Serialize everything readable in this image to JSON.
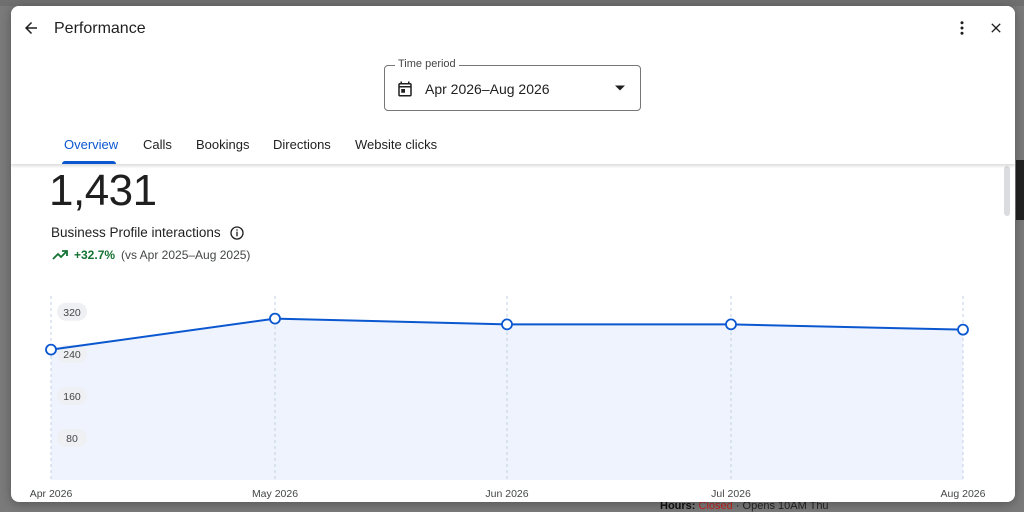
{
  "dialog": {
    "title": "Performance",
    "time_period": {
      "label": "Time period",
      "value": "Apr 2026–Aug 2026"
    },
    "tabs": [
      {
        "label": "Overview",
        "active": true
      },
      {
        "label": "Calls",
        "active": false
      },
      {
        "label": "Bookings",
        "active": false
      },
      {
        "label": "Directions",
        "active": false
      },
      {
        "label": "Website clicks",
        "active": false
      }
    ]
  },
  "summary": {
    "total": "1,431",
    "metric_label": "Business Profile interactions",
    "change": "+32.7%",
    "comparison": "(vs Apr 2025–Aug 2025)"
  },
  "background": {
    "hours_label": "Hours:",
    "status": "Closed",
    "opens": " · Opens 10AM Thu"
  },
  "colors": {
    "accent": "#0b57d0",
    "positive": "#137333",
    "area_fill": "#eef3fd"
  },
  "icons": [
    "back-arrow-icon",
    "more-vert-icon",
    "close-icon",
    "calendar-icon",
    "dropdown-arrow-icon",
    "info-icon",
    "trending-up-icon"
  ],
  "chart_data": {
    "type": "area",
    "categories": [
      "Apr 2026",
      "May 2026",
      "Jun 2026",
      "Jul 2026",
      "Aug 2026"
    ],
    "y_ticks": [
      80,
      160,
      240,
      320
    ],
    "ylim": [
      0,
      350
    ],
    "series": [
      {
        "values": [
          248,
          307,
          296,
          296,
          286
        ]
      }
    ],
    "grid": "vertical-dashed"
  }
}
